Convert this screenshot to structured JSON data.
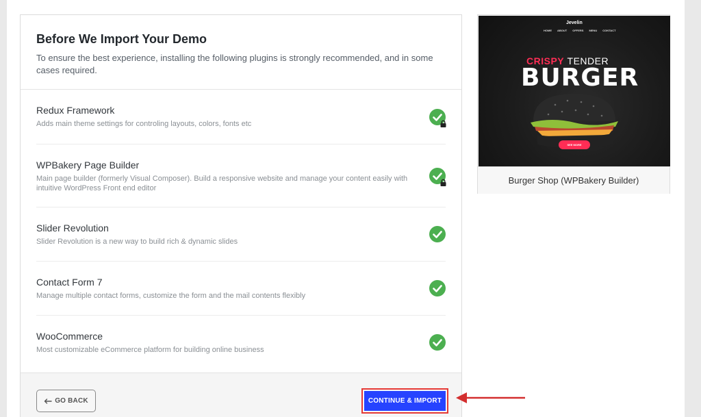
{
  "panel": {
    "title": "Before We Import Your Demo",
    "description": "To ensure the best experience, installing the following plugins is strongly recommended, and in some cases required."
  },
  "plugins": [
    {
      "name": "Redux Framework",
      "description": "Adds main theme settings for controling layouts, colors, fonts etc",
      "status": "installed",
      "required": true
    },
    {
      "name": "WPBakery Page Builder",
      "description": "Main page builder (formerly Visual Composer). Build a responsive website and manage your content easily with intuitive WordPress Front end editor",
      "status": "installed",
      "required": true
    },
    {
      "name": "Slider Revolution",
      "description": "Slider Revolution is a new way to build rich & dynamic slides",
      "status": "installed",
      "required": false
    },
    {
      "name": "Contact Form 7",
      "description": "Manage multiple contact forms, customize the form and the mail contents flexibly",
      "status": "installed",
      "required": false
    },
    {
      "name": "WooCommerce",
      "description": "Most customizable eCommerce platform for building online business",
      "status": "installed",
      "required": false
    }
  ],
  "footer": {
    "back_label": "GO BACK",
    "import_label": "CONTINUE & IMPORT"
  },
  "preview": {
    "caption": "Burger Shop (WPBakery Builder)",
    "mock_logo": "Jevelin",
    "mock_nav": [
      "HOME",
      "ABOUT",
      "OFFERS",
      "MENU",
      "CONTACT"
    ],
    "mock_tag_accent": "CRISPY",
    "mock_tag_rest": "TENDER",
    "mock_headline": "BURGER",
    "mock_cta": "SEE MORE"
  },
  "colors": {
    "check_green": "#4caf50",
    "import_blue": "#2643ff",
    "highlight_red": "#e53935"
  },
  "icons": {
    "check": "check-circle-icon",
    "lock": "lock-icon",
    "back": "arrow-left-icon",
    "pointer": "arrow-left-annotation-icon"
  }
}
